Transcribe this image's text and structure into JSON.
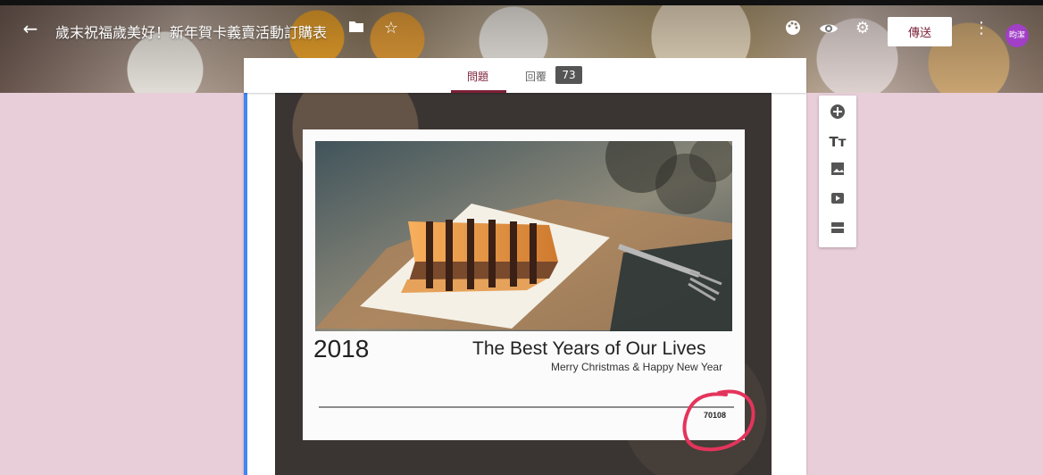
{
  "form": {
    "title": "歲末祝福歲美好！新年賀卡義賣活動訂購表",
    "send_label": "傳送",
    "avatar_text": "昀潔"
  },
  "tabs": [
    {
      "label": "問題",
      "active": true
    },
    {
      "label": "回覆",
      "active": false,
      "count": "73"
    }
  ],
  "poster": {
    "year": "2018",
    "slogan": "The Best Years of Our Lives",
    "greeting": "Merry Christmas & Happy New Year",
    "serial": "70108"
  },
  "colors": {
    "accent": "#7c1f36",
    "page_background": "#e8ced9",
    "active_field": "#4285f4",
    "annotation": "#e4345c",
    "avatar": "#a13fc6"
  },
  "icons": {
    "header": [
      "back-arrow-icon",
      "folder-icon",
      "star-icon",
      "palette-icon",
      "eye-icon",
      "gear-icon",
      "more-vert-icon"
    ],
    "toolbar": [
      "add-question-icon",
      "title-text-icon",
      "image-icon",
      "video-icon",
      "section-icon"
    ]
  }
}
